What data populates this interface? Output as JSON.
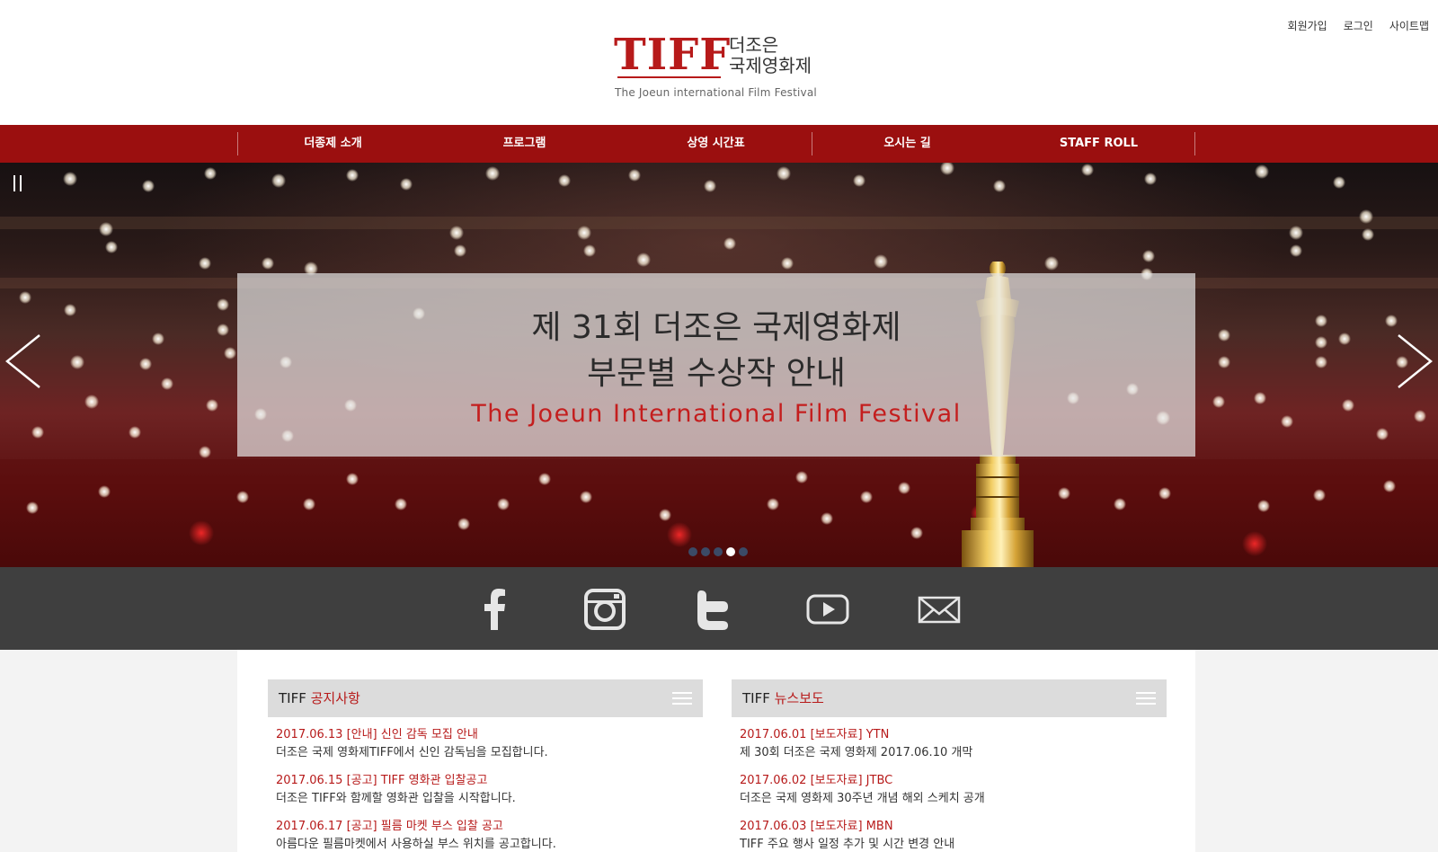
{
  "util_links": [
    "회원가입",
    "로그인",
    "사이트맵"
  ],
  "logo": {
    "main": "TIFF",
    "ko_line1": "더조은",
    "ko_line2": "국제영화제",
    "en": "The Joeun international Film Festival"
  },
  "nav": [
    "더종제 소개",
    "프로그램",
    "상영 시간표",
    "오시는 길",
    "STAFF ROLL"
  ],
  "hero": {
    "line1": "제 31회 더조은 국제영화제",
    "line2": "부문별 수상작 안내",
    "line3": "The Joeun International Film Festival",
    "slide_count": 5,
    "active_slide": 4
  },
  "social_icons": [
    "facebook-icon",
    "instagram-icon",
    "twitter-icon",
    "youtube-icon",
    "mail-icon"
  ],
  "notice": {
    "prefix": "TIFF",
    "title": "공지사항",
    "items": [
      {
        "title": "2017.06.13 [안내] 신인 감독 모집 안내",
        "desc": "더조은 국제 영화제TIFF에서 신인 감독님을 모집합니다."
      },
      {
        "title": "2017.06.15 [공고] TIFF 영화관 입찰공고",
        "desc": "더조은 TIFF와 함께할 영화관 입찰을 시작합니다."
      },
      {
        "title": "2017.06.17 [공고] 필름 마켓 부스 입찰 공고",
        "desc": "아름다운 필름마켓에서 사용하실 부스 위치를 공고합니다."
      }
    ]
  },
  "news": {
    "prefix": "TIFF",
    "title": "뉴스보도",
    "items": [
      {
        "title": "2017.06.01 [보도자료] YTN",
        "desc": "제 30회 더조은 국제 영화제 2017.06.10 개막"
      },
      {
        "title": "2017.06.02 [보도자료] JTBC",
        "desc": "더조은 국제 영화제 30주년 개념 해외 스케치 공개"
      },
      {
        "title": "2017.06.03 [보도자료] MBN",
        "desc": "TIFF 주요 행사 일정 추가 및 시간 변경 안내"
      }
    ]
  },
  "colors": {
    "brand_red": "#9b0f0f",
    "accent_red": "#b71a1a",
    "social_bar": "#3f3f3f"
  }
}
